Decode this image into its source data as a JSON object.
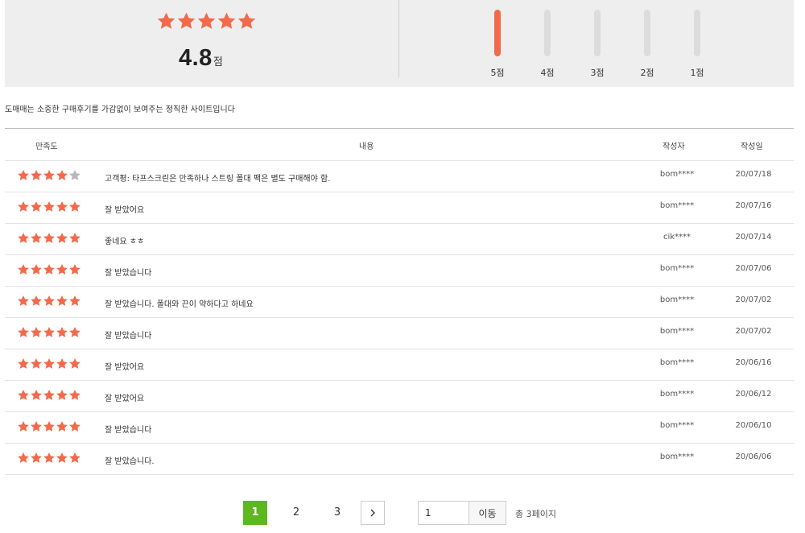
{
  "colors": {
    "star_filled": "#f26a4b",
    "star_empty": "#b8b8b8",
    "bar_fill": "#f26a4b",
    "bar_track": "#dcdcdc",
    "page_active": "#5cb81e"
  },
  "summary": {
    "average_rating": 5,
    "score": "4.8",
    "score_unit": "점",
    "distribution": [
      {
        "label": "5점",
        "fraction": 1.0
      },
      {
        "label": "4점",
        "fraction": 0.0
      },
      {
        "label": "3점",
        "fraction": 0.0
      },
      {
        "label": "2점",
        "fraction": 0.0
      },
      {
        "label": "1점",
        "fraction": 0.0
      }
    ]
  },
  "notice": "도매매는 소중한 구매후기를 가감없이 보여주는 정직한 사이트입니다",
  "table": {
    "headers": {
      "rating": "만족도",
      "content": "내용",
      "author": "작성자",
      "date": "작성일"
    },
    "rows": [
      {
        "rating": 4,
        "content": "고객평: 타프스크린은 만족하나 스트링 폴대 팩은 별도 구매해야 함.",
        "author": "bom****",
        "date": "20/07/18"
      },
      {
        "rating": 5,
        "content": "잘 받았어요",
        "author": "bom****",
        "date": "20/07/16"
      },
      {
        "rating": 5,
        "content": "좋네요 ㅎㅎ",
        "author": "cik****",
        "date": "20/07/14"
      },
      {
        "rating": 5,
        "content": "잘 받았습니다",
        "author": "bom****",
        "date": "20/07/06"
      },
      {
        "rating": 5,
        "content": "잘 받았습니다. 폴대와 끈이 약하다고 하네요",
        "author": "bom****",
        "date": "20/07/02"
      },
      {
        "rating": 5,
        "content": "잘 받았습니다",
        "author": "bom****",
        "date": "20/07/02"
      },
      {
        "rating": 5,
        "content": "잘 받았어요",
        "author": "bom****",
        "date": "20/06/16"
      },
      {
        "rating": 5,
        "content": "잘 받았어요",
        "author": "bom****",
        "date": "20/06/12"
      },
      {
        "rating": 5,
        "content": "잘 받았습니다",
        "author": "bom****",
        "date": "20/06/10"
      },
      {
        "rating": 5,
        "content": "잘 받았습니다.",
        "author": "bom****",
        "date": "20/06/06"
      }
    ]
  },
  "pagination": {
    "pages": [
      "1",
      "2",
      "3"
    ],
    "current": "1",
    "next_icon": "chevron-right-icon",
    "input_value": "1",
    "go_label": "이동",
    "total_label": "총 3페이지"
  }
}
